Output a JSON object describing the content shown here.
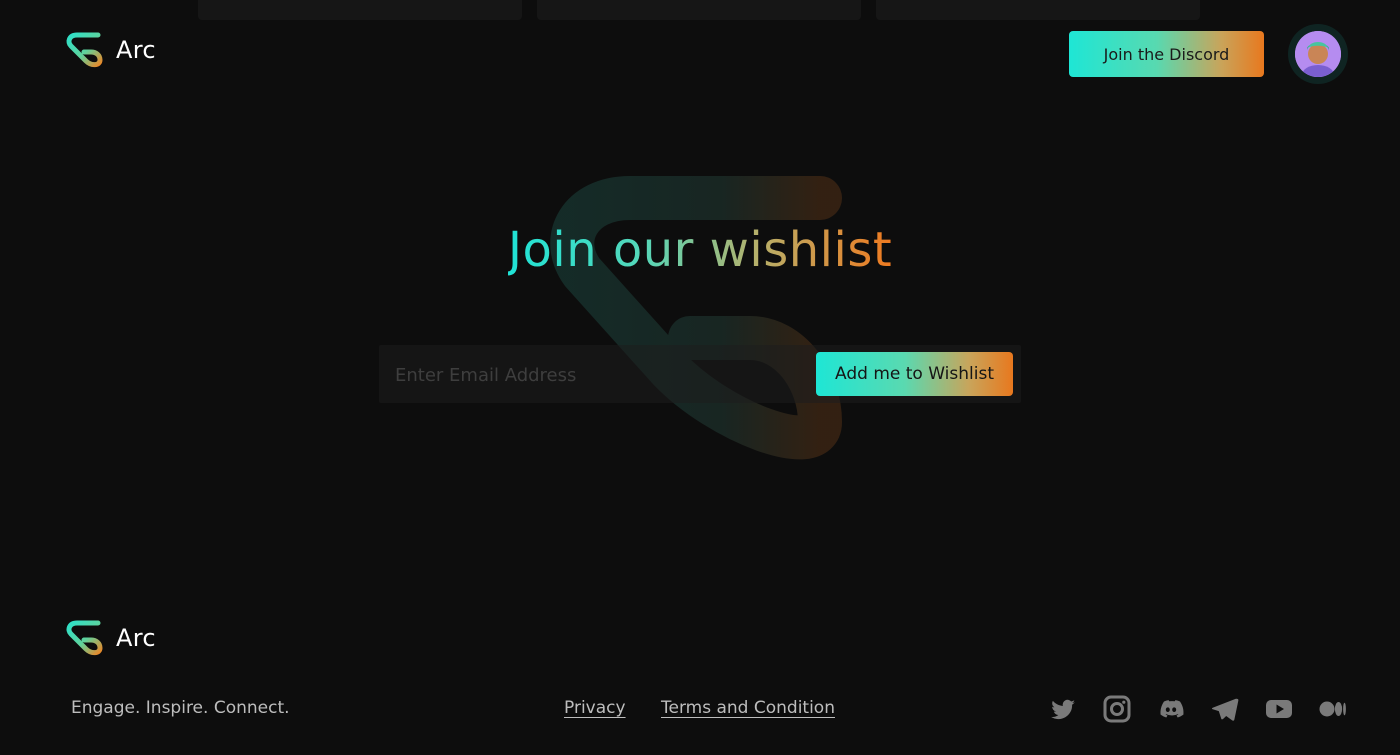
{
  "header": {
    "brand_name": "Arc",
    "discord_button_label": "Join the Discord",
    "avatar_icon": "avatar-icon"
  },
  "hero": {
    "title": "Join our wishlist",
    "email_placeholder": "Enter Email Address",
    "email_value": "",
    "submit_label": "Add me to Wishlist"
  },
  "footer": {
    "brand_name": "Arc",
    "tagline": "Engage. Inspire. Connect.",
    "links": [
      {
        "label": "Privacy"
      },
      {
        "label": "Terms and Condition"
      }
    ],
    "socials": [
      "twitter-icon",
      "instagram-icon",
      "discord-icon",
      "telegram-icon",
      "youtube-icon",
      "medium-icon"
    ]
  },
  "colors": {
    "background": "#0d0d0d",
    "accent_teal": "#1ee6d5",
    "accent_orange": "#e8781e",
    "text_muted": "#bdbdbd"
  }
}
